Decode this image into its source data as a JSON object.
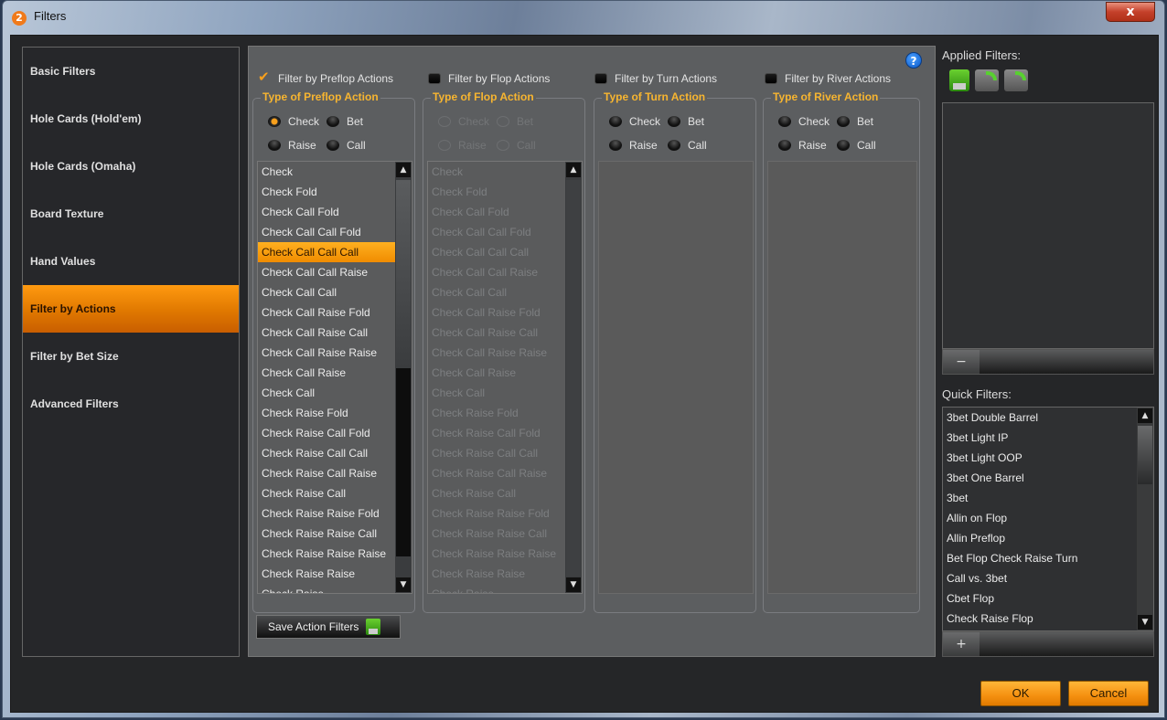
{
  "window": {
    "title": "Filters",
    "app_icon_glyph": "2",
    "close_glyph": "x"
  },
  "sidebar": {
    "items": [
      {
        "label": "Basic Filters",
        "active": false
      },
      {
        "label": "Hole Cards (Hold'em)",
        "active": false
      },
      {
        "label": "Hole Cards (Omaha)",
        "active": false
      },
      {
        "label": "Board Texture",
        "active": false
      },
      {
        "label": "Hand Values",
        "active": false
      },
      {
        "label": "Filter by Actions",
        "active": true
      },
      {
        "label": "Filter by Bet Size",
        "active": false
      },
      {
        "label": "Advanced Filters",
        "active": false
      }
    ]
  },
  "main": {
    "help_glyph": "?",
    "streets": [
      {
        "checkbox_label": "Filter by Preflop Actions",
        "checked": true,
        "enabled": true,
        "group_title": "Type of Preflop Action",
        "radios": [
          "Check",
          "Bet",
          "Raise",
          "Call"
        ],
        "selected_radio": "Check",
        "list": [
          "Check",
          "Check Fold",
          "Check Call Fold",
          "Check Call Call Fold",
          "Check Call Call Call",
          "Check Call Call Raise",
          "Check Call Call",
          "Check Call Raise Fold",
          "Check Call Raise Call",
          "Check Call Raise Raise",
          "Check Call Raise",
          "Check Call",
          "Check Raise Fold",
          "Check Raise Call Fold",
          "Check Raise Call Call",
          "Check Raise Call Raise",
          "Check Raise Call",
          "Check Raise Raise Fold",
          "Check Raise Raise Call",
          "Check Raise Raise Raise",
          "Check Raise Raise",
          "Check Raise"
        ],
        "selected_item": "Check Call Call Call"
      },
      {
        "checkbox_label": "Filter by Flop Actions",
        "checked": false,
        "enabled": false,
        "group_title": "Type of Flop Action",
        "radios": [
          "Check",
          "Bet",
          "Raise",
          "Call"
        ],
        "selected_radio": "",
        "list": [
          "Check",
          "Check Fold",
          "Check Call Fold",
          "Check Call Call Fold",
          "Check Call Call Call",
          "Check Call Call Raise",
          "Check Call Call",
          "Check Call Raise Fold",
          "Check Call Raise Call",
          "Check Call Raise Raise",
          "Check Call Raise",
          "Check Call",
          "Check Raise Fold",
          "Check Raise Call Fold",
          "Check Raise Call Call",
          "Check Raise Call Raise",
          "Check Raise Call",
          "Check Raise Raise Fold",
          "Check Raise Raise Call",
          "Check Raise Raise Raise",
          "Check Raise Raise",
          "Check Raise"
        ],
        "selected_item": ""
      },
      {
        "checkbox_label": "Filter by Turn Actions",
        "checked": false,
        "enabled": true,
        "group_title": "Type of Turn Action",
        "radios": [
          "Check",
          "Bet",
          "Raise",
          "Call"
        ],
        "selected_radio": "",
        "list": [],
        "selected_item": ""
      },
      {
        "checkbox_label": "Filter by River Actions",
        "checked": false,
        "enabled": true,
        "group_title": "Type of River Action",
        "radios": [
          "Check",
          "Bet",
          "Raise",
          "Call"
        ],
        "selected_radio": "",
        "list": [],
        "selected_item": ""
      }
    ],
    "save_button_label": "Save Action Filters"
  },
  "applied_filters": {
    "label": "Applied Filters:",
    "toolbar_icons": [
      "save-download-icon",
      "load-folder-icon",
      "add-folder-icon"
    ],
    "items": [],
    "remove_glyph": "−"
  },
  "quick_filters": {
    "label": "Quick Filters:",
    "items": [
      "3bet Double Barrel",
      "3bet Light IP",
      "3bet Light OOP",
      "3bet One Barrel",
      "3bet",
      "Allin on Flop",
      "Allin Preflop",
      "Bet Flop Check Raise Turn",
      "Call vs. 3bet",
      "Cbet Flop",
      "Check Raise Flop"
    ],
    "add_glyph": "+"
  },
  "footer": {
    "ok_label": "OK",
    "cancel_label": "Cancel"
  },
  "colors": {
    "accent": "#f59010",
    "group_title": "#f7b530",
    "help": "#0a58c8"
  }
}
